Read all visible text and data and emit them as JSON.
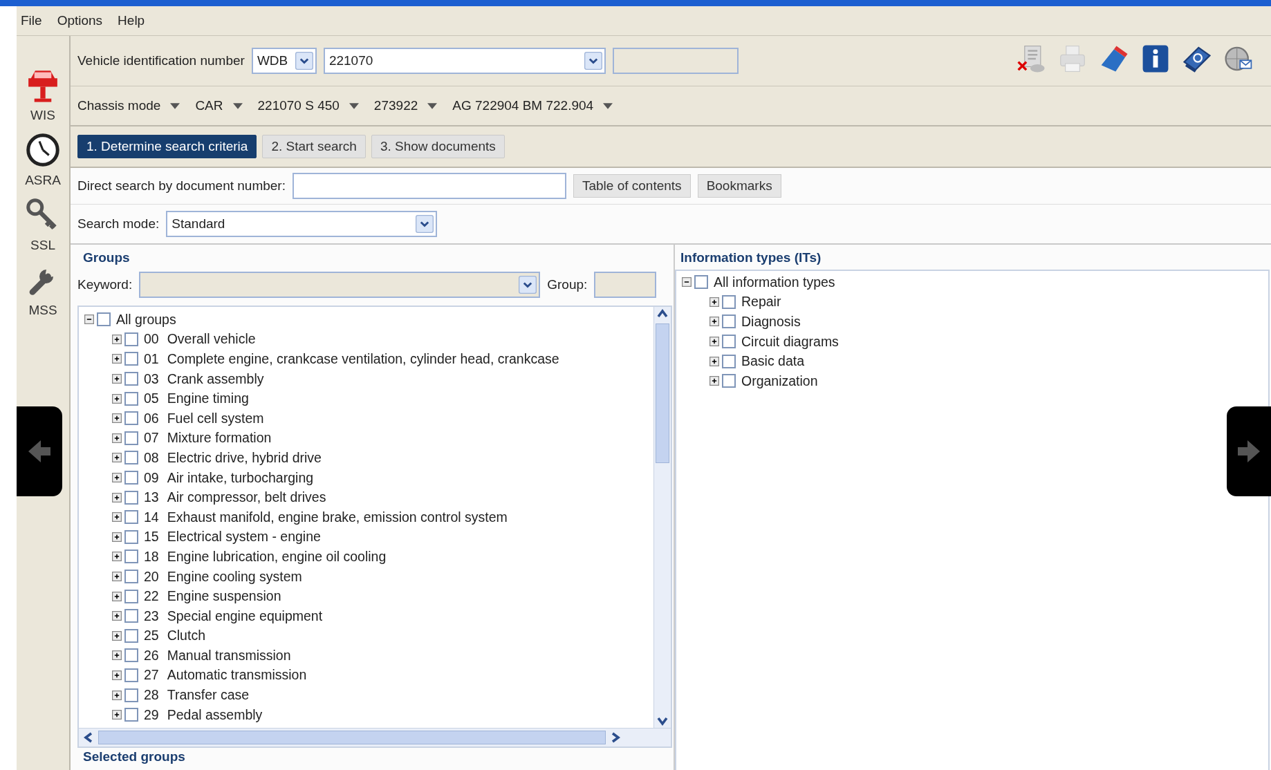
{
  "menu": [
    "File",
    "Options",
    "Help"
  ],
  "sidebar": [
    {
      "label": "WIS",
      "kind": "car"
    },
    {
      "label": "ASRA",
      "kind": "clock"
    },
    {
      "label": "SSL",
      "kind": "key"
    },
    {
      "label": "MSS",
      "kind": "wrench"
    }
  ],
  "vin": {
    "label": "Vehicle identification number",
    "prefix": "WDB",
    "value": "221070"
  },
  "chassis": [
    "Chassis mode",
    "CAR",
    "221070 S 450",
    "273922",
    "AG 722904 BM 722.904"
  ],
  "steps": [
    {
      "label": "1. Determine search criteria",
      "selected": true
    },
    {
      "label": "2. Start search",
      "selected": false
    },
    {
      "label": "3. Show documents",
      "selected": false
    }
  ],
  "direct_search": {
    "label": "Direct search by document number:",
    "buttons": [
      "Table of contents",
      "Bookmarks"
    ]
  },
  "search_mode": {
    "label": "Search mode:",
    "value": "Standard"
  },
  "groups": {
    "title": "Groups",
    "keyword_label": "Keyword:",
    "group_label": "Group:",
    "tree": {
      "label": "All groups",
      "expanded": true,
      "checked": false,
      "children": [
        {
          "code": "00",
          "label": "Overall vehicle",
          "expanded": false,
          "checked": false
        },
        {
          "code": "01",
          "label": "Complete engine, crankcase ventilation, cylinder head, crankcase",
          "expanded": false,
          "checked": false
        },
        {
          "code": "03",
          "label": "Crank assembly",
          "expanded": false,
          "checked": false
        },
        {
          "code": "05",
          "label": "Engine timing",
          "expanded": false,
          "checked": false
        },
        {
          "code": "06",
          "label": "Fuel cell system",
          "expanded": false,
          "checked": false
        },
        {
          "code": "07",
          "label": "Mixture formation",
          "expanded": false,
          "checked": false
        },
        {
          "code": "08",
          "label": "Electric drive, hybrid drive",
          "expanded": false,
          "checked": false
        },
        {
          "code": "09",
          "label": "Air intake, turbocharging",
          "expanded": false,
          "checked": false
        },
        {
          "code": "13",
          "label": "Air compressor, belt drives",
          "expanded": false,
          "checked": false
        },
        {
          "code": "14",
          "label": "Exhaust manifold, engine brake, emission control system",
          "expanded": false,
          "checked": false
        },
        {
          "code": "15",
          "label": "Electrical system - engine",
          "expanded": false,
          "checked": false
        },
        {
          "code": "18",
          "label": "Engine lubrication, engine oil cooling",
          "expanded": false,
          "checked": false
        },
        {
          "code": "20",
          "label": "Engine cooling system",
          "expanded": false,
          "checked": false
        },
        {
          "code": "22",
          "label": "Engine suspension",
          "expanded": false,
          "checked": false
        },
        {
          "code": "23",
          "label": "Special engine equipment",
          "expanded": false,
          "checked": false
        },
        {
          "code": "25",
          "label": "Clutch",
          "expanded": false,
          "checked": false
        },
        {
          "code": "26",
          "label": "Manual transmission",
          "expanded": false,
          "checked": false
        },
        {
          "code": "27",
          "label": "Automatic transmission",
          "expanded": false,
          "checked": false
        },
        {
          "code": "28",
          "label": "Transfer case",
          "expanded": false,
          "checked": false
        },
        {
          "code": "29",
          "label": "Pedal assembly",
          "expanded": false,
          "checked": false
        }
      ]
    }
  },
  "selected_groups": {
    "title": "Selected groups"
  },
  "info_types": {
    "title": "Information types (ITs)",
    "tree": {
      "label": "All information types",
      "expanded": true,
      "checked": false,
      "children": [
        {
          "label": "Repair",
          "expanded": false,
          "checked": false
        },
        {
          "label": "Diagnosis",
          "expanded": false,
          "checked": false
        },
        {
          "label": "Circuit diagrams",
          "expanded": false,
          "checked": false
        },
        {
          "label": "Basic data",
          "expanded": false,
          "checked": false
        },
        {
          "label": "Organization",
          "expanded": false,
          "checked": false
        }
      ]
    }
  }
}
